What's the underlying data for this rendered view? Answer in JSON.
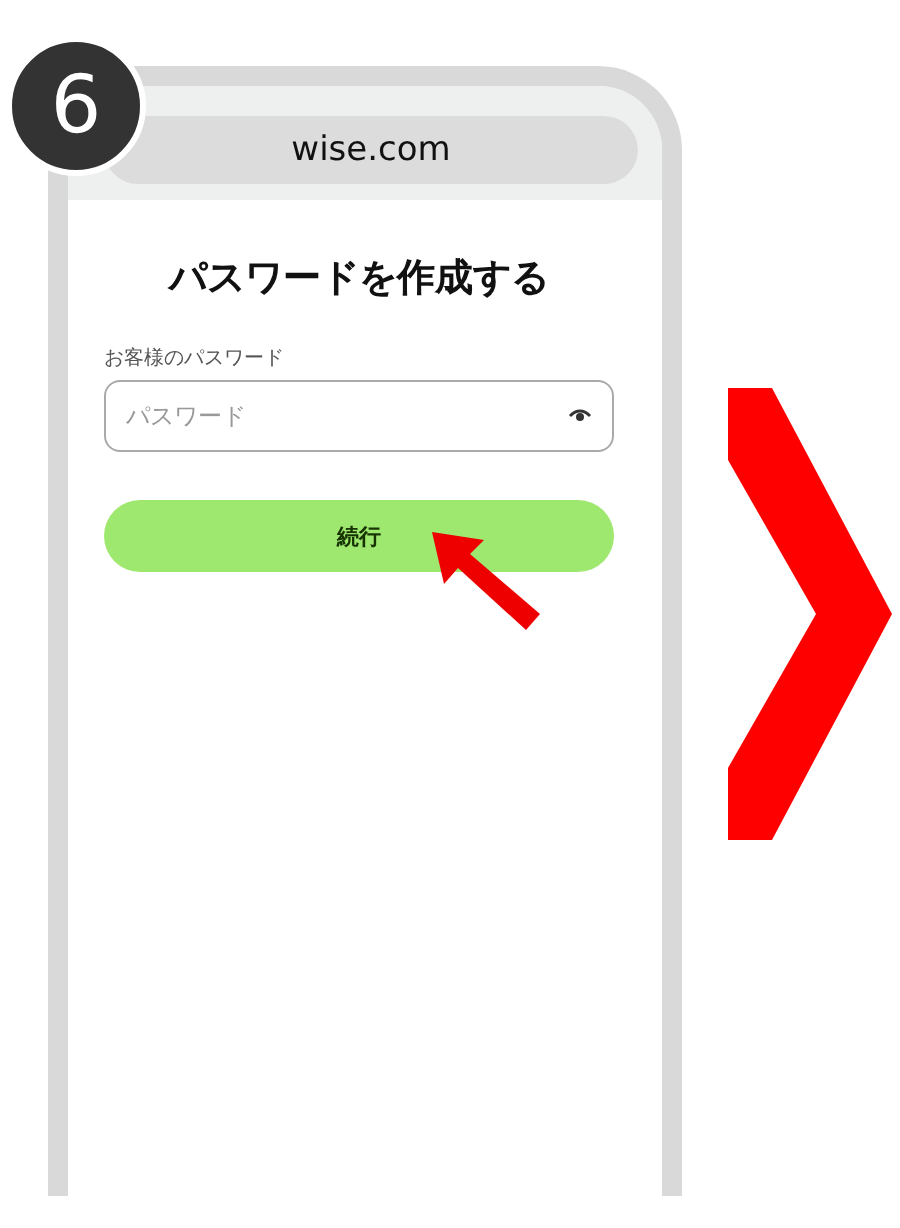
{
  "step_badge": "6",
  "address_bar": {
    "url": "wise.com"
  },
  "page": {
    "title": "パスワードを作成する",
    "password_field": {
      "label": "お客様のパスワード",
      "placeholder": "パスワード"
    },
    "continue_button": "続行"
  }
}
